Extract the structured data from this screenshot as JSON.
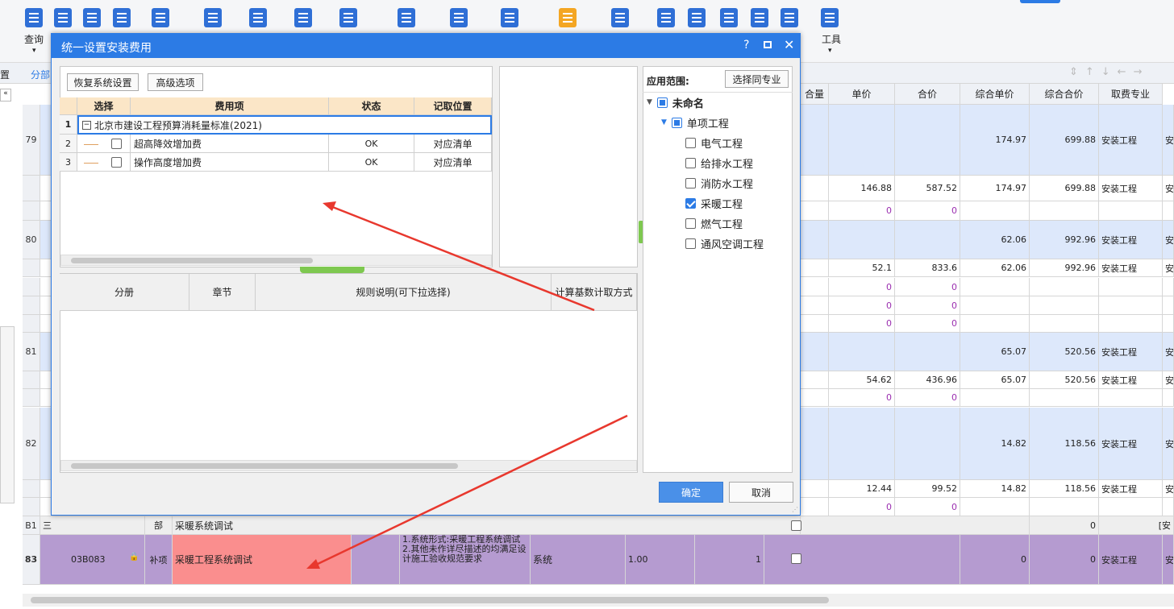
{
  "toolbar": {
    "query_label": "查询",
    "tools_label": "工具"
  },
  "left_labels": {
    "tab_left": "分部",
    "tab_tiny": "置"
  },
  "grid": {
    "headers": [
      "合量",
      "单价",
      "合价",
      "综合单价",
      "综合合价",
      "取费专业"
    ],
    "rows": [
      {
        "no": "79",
        "unit": "",
        "total": "",
        "cunit": "174.97",
        "ctotal": "699.88",
        "prof": "安装工程"
      },
      {
        "no": "",
        "unit": "146.88",
        "total": "587.52",
        "cunit": "174.97",
        "ctotal": "699.88",
        "prof": "安装工程"
      },
      {
        "no": "",
        "unit": "0",
        "total": "0",
        "cunit": "",
        "ctotal": "",
        "prof": ""
      },
      {
        "no": "80",
        "unit": "",
        "total": "",
        "cunit": "62.06",
        "ctotal": "992.96",
        "prof": "安装工程"
      },
      {
        "no": "",
        "unit": "52.1",
        "total": "833.6",
        "cunit": "62.06",
        "ctotal": "992.96",
        "prof": "安装工程"
      },
      {
        "no": "",
        "unit": "0",
        "total": "0",
        "cunit": "",
        "ctotal": "",
        "prof": ""
      },
      {
        "no": "",
        "unit": "0",
        "total": "0",
        "cunit": "",
        "ctotal": "",
        "prof": ""
      },
      {
        "no": "",
        "unit": "0",
        "total": "0",
        "cunit": "",
        "ctotal": "",
        "prof": ""
      },
      {
        "no": "81",
        "unit": "",
        "total": "",
        "cunit": "65.07",
        "ctotal": "520.56",
        "prof": "安装工程"
      },
      {
        "no": "",
        "unit": "54.62",
        "total": "436.96",
        "cunit": "65.07",
        "ctotal": "520.56",
        "prof": "安装工程"
      },
      {
        "no": "",
        "unit": "0",
        "total": "0",
        "cunit": "",
        "ctotal": "",
        "prof": ""
      },
      {
        "no": "82",
        "unit": "",
        "total": "",
        "cunit": "14.82",
        "ctotal": "118.56",
        "prof": "安装工程"
      },
      {
        "no": "",
        "unit": "12.44",
        "total": "99.52",
        "cunit": "14.82",
        "ctotal": "118.56",
        "prof": "安装工程"
      },
      {
        "no": "",
        "unit": "0",
        "total": "0",
        "cunit": "",
        "ctotal": "",
        "prof": ""
      }
    ],
    "b1": {
      "no": "B1",
      "section": "三",
      "type": "部",
      "name": "采暖系统调试",
      "ctotal": "0"
    },
    "r83": {
      "no": "83",
      "code": "03B083",
      "type": "补项",
      "name": "采暖工程系统调试",
      "desc1": "1.系统形式:采暖工程系统调试",
      "desc2": "2.其他未作详尽描述的均满足设计施工验收规范要求",
      "unit_name": "系统",
      "qty": "1.00",
      "qty2": "1",
      "cunit": "0",
      "ctotal": "0",
      "prof": "安装工程"
    },
    "prof_short": "安",
    "b1_tag": "[安"
  },
  "dialog": {
    "title": "统一设置安装费用",
    "help_icon": "?",
    "restore_button": "恢复系统设置",
    "advanced_button": "高级选项",
    "table_headers": [
      "选择",
      "费用项",
      "状态",
      "记取位置"
    ],
    "table_rows": [
      {
        "no": "1",
        "name": "北京市建设工程预算消耗量标准(2021)",
        "status": "",
        "pos": ""
      },
      {
        "no": "2",
        "name": "超高降效增加费",
        "status": "OK",
        "pos": "对应清单"
      },
      {
        "no": "3",
        "name": "操作高度增加费",
        "status": "OK",
        "pos": "对应清单"
      }
    ],
    "lower_headers": [
      "分册",
      "章节",
      "规则说明(可下拉选择)",
      "计算基数计取方式"
    ],
    "scope_label": "应用范围:",
    "select_same_button": "选择同专业",
    "tree": [
      {
        "label": "未命名",
        "state": "part",
        "level": 0
      },
      {
        "label": "单项工程",
        "state": "part",
        "level": 1
      },
      {
        "label": "电气工程",
        "state": "off",
        "level": 2
      },
      {
        "label": "给排水工程",
        "state": "off",
        "level": 2
      },
      {
        "label": "消防水工程",
        "state": "off",
        "level": 2
      },
      {
        "label": "采暖工程",
        "state": "on",
        "level": 2
      },
      {
        "label": "燃气工程",
        "state": "off",
        "level": 2
      },
      {
        "label": "通风空调工程",
        "state": "off",
        "level": 2
      }
    ],
    "ok_button": "确定",
    "cancel_button": "取消"
  }
}
